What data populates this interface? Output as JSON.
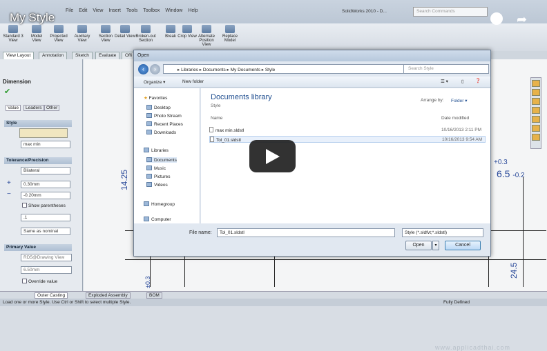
{
  "video": {
    "title": "My Style"
  },
  "menu": [
    "File",
    "Edit",
    "View",
    "Insert",
    "Tools",
    "Toolbox",
    "Window",
    "Help"
  ],
  "app_title": "SolidWorks 2010 - D...",
  "search_commands_placeholder": "Search Commands",
  "ribbon": {
    "buttons": [
      "Standard 3 View",
      "Model View",
      "Projected View",
      "Auxiliary View",
      "Section View",
      "Detail View",
      "Broken-out Section",
      "Break",
      "Crop View",
      "Alternate Position View",
      "Replace Model"
    ]
  },
  "tabs": [
    "View Layout",
    "Annotation",
    "Sketch",
    "Evaluate",
    "Offi"
  ],
  "left_panel": {
    "title": "Dimension",
    "subtabs": [
      "Value",
      "Leaders",
      "Other"
    ],
    "style_header": "Style",
    "style_value": "max min",
    "tolerance_header": "Tolerance/Precision",
    "tolerance_type": "Bilateral",
    "plus_value": "0.30mm",
    "minus_value": "-0.20mm",
    "show_parentheses": "Show parentheses",
    "precision": ".1",
    "precision2": "Same as nominal",
    "primary_header": "Primary Value",
    "primary_ref": "RD5@Drawing View",
    "primary_value": "6.50mm",
    "override": "Override value"
  },
  "drawing": {
    "dim_top": "+0.3",
    "dim_main": "6.5",
    "dim_bottom": "-0.2",
    "dim_vertical_left": "14.25",
    "dim_vertical_right": "24.5",
    "dim_small": "±0.3"
  },
  "bottom_tabs": [
    "Outer Casting",
    "Exploded Assembly",
    "BOM"
  ],
  "status": {
    "left": "Load one or more Style. Use Ctrl or Shift to select multiple Style.",
    "right": "Fully Defined"
  },
  "dialog": {
    "title": "Open",
    "breadcrumb": "▸ Libraries ▸ Documents ▸ My Documents ▸ Style",
    "search_placeholder": "Search Style",
    "organize": "Organize ▾",
    "new_folder": "New folder",
    "nav": {
      "favorites": "Favorites",
      "fav_items": [
        "Desktop",
        "Photo Stream",
        "Recent Places",
        "Downloads"
      ],
      "libraries": "Libraries",
      "lib_items": [
        "Documents",
        "Music",
        "Pictures",
        "Videos"
      ],
      "homegroup": "Homegroup",
      "computer": "Computer"
    },
    "library_title": "Documents library",
    "library_sub": "Style",
    "arrange_label": "Arrange by:",
    "arrange_value": "Folder ▾",
    "col_name": "Name",
    "col_date": "Date modified",
    "files": [
      {
        "name": "max min.sldstl",
        "date": "10/16/2013 2:11 PM"
      },
      {
        "name": "Tol_01.sldstl",
        "date": "10/16/2013 9:54 AM"
      }
    ],
    "filename_label": "File name:",
    "filename_value": "Tol_01.sldstl",
    "filetype": "Style (*.sldfvt;*.sldstl)",
    "open_label": "Open",
    "cancel_label": "Cancel"
  },
  "watermark": "www.applicadthai.com"
}
